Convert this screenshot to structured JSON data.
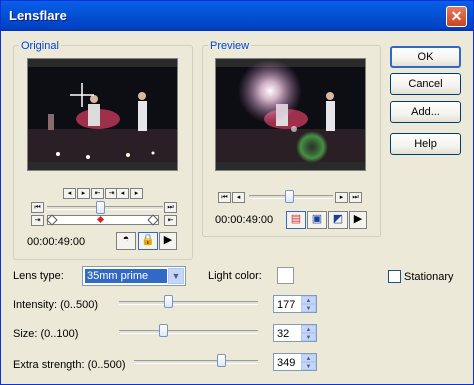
{
  "window": {
    "title": "Lensflare",
    "close_symbol": "✕"
  },
  "buttons": {
    "ok": "OK",
    "cancel": "Cancel",
    "add": "Add...",
    "help": "Help"
  },
  "original": {
    "label": "Original",
    "time": "00:00:49:00"
  },
  "preview": {
    "label": "Preview",
    "time": "00:00:49:00"
  },
  "settings": {
    "lens_type_label": "Lens type:",
    "lens_type_value": "35mm prime",
    "light_color_label": "Light color:",
    "stationary_label": "Stationary",
    "intensity": {
      "label": "Intensity: (0..500)",
      "value": "177",
      "fraction": 0.354
    },
    "size": {
      "label": "Size: (0..100)",
      "value": "32",
      "fraction": 0.32
    },
    "extra_strength": {
      "label": "Extra strength: (0..500)",
      "value": "349",
      "fraction": 0.698
    }
  }
}
